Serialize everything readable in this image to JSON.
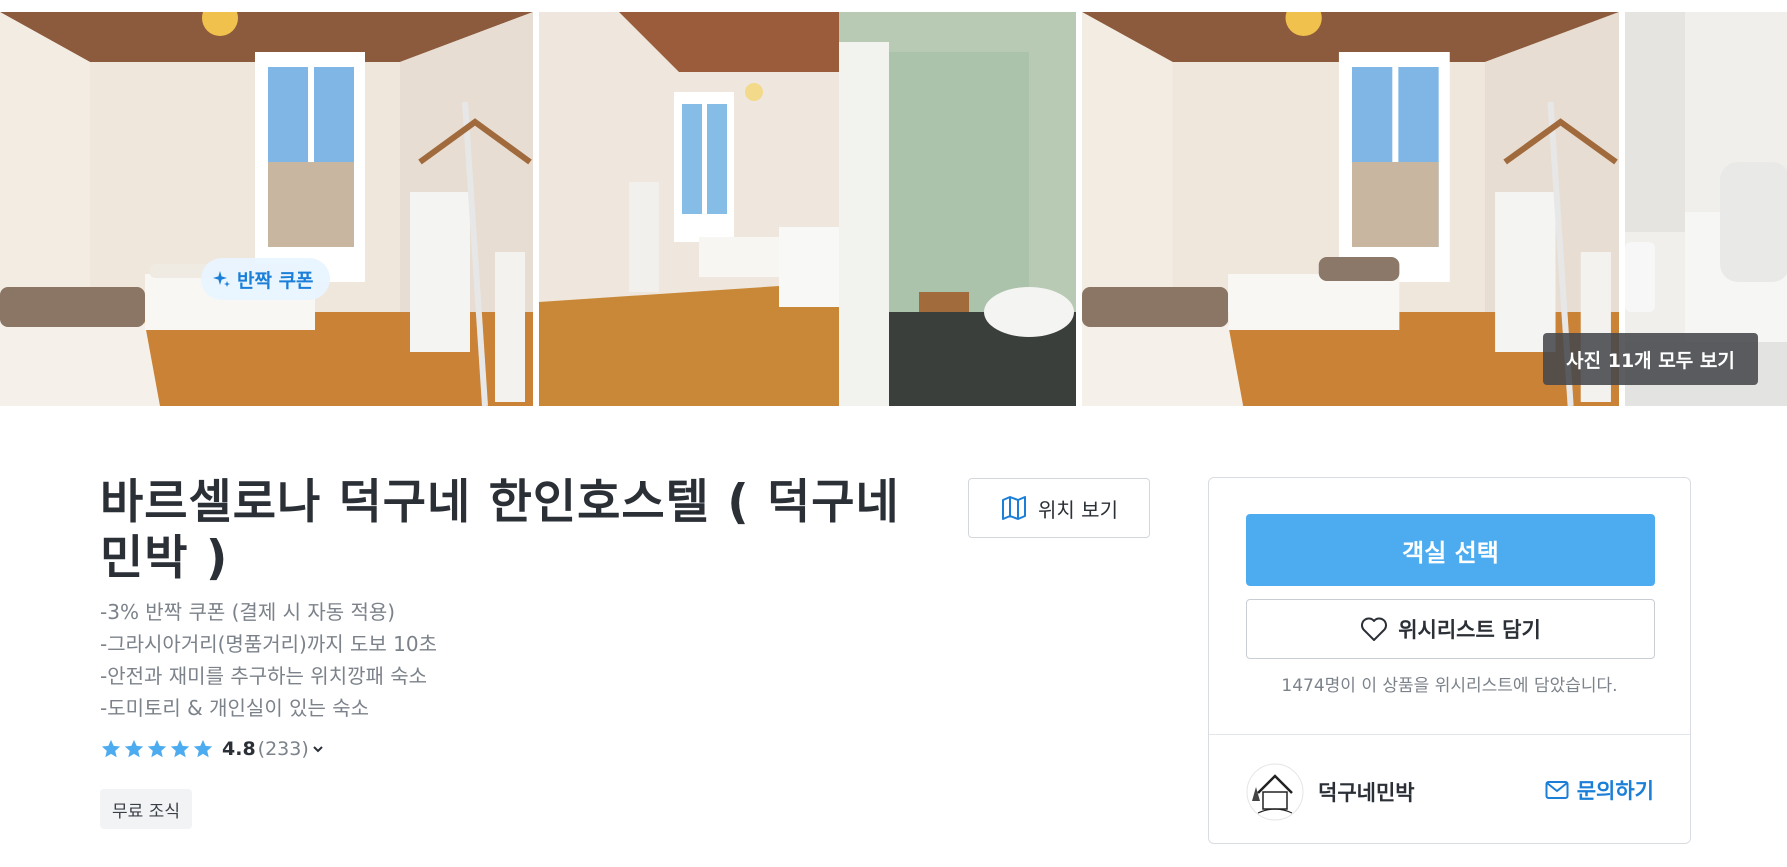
{
  "gallery": {
    "photos": [
      "room-photo-1",
      "room-photo-2",
      "room-photo-3",
      "bathroom-photo-4"
    ],
    "coupon_chip": "반짝 쿠폰",
    "view_all": "사진 11개 모두 보기"
  },
  "listing": {
    "title": "바르셀로나 덕구네 한인호스텔 ( 덕구네 민박 )",
    "map_button": "위치 보기",
    "highlights": [
      "-3% 반짝 쿠폰 (결제 시 자동 적용)",
      "-그라시아거리(명품거리)까지 도보 10초",
      "-안전과 재미를 추구하는 위치깡패 숙소",
      "-도미토리 & 개인실이 있는 숙소"
    ],
    "rating": {
      "score": "4.8",
      "count": "(233)",
      "stars": 5
    },
    "tag": "무료 조식"
  },
  "booking": {
    "select_button": "객실 선택",
    "wishlist_button": "위시리스트 담기",
    "wishlist_note": "1474명이 이 상품을 위시리스트에 담았습니다.",
    "host_name": "덕구네민박",
    "inquiry_button": "문의하기"
  },
  "colors": {
    "accent": "#4dabf0",
    "link": "#1b7fd8",
    "star": "#4dabf0",
    "text": "#2b2f36",
    "muted": "#7c828a"
  }
}
